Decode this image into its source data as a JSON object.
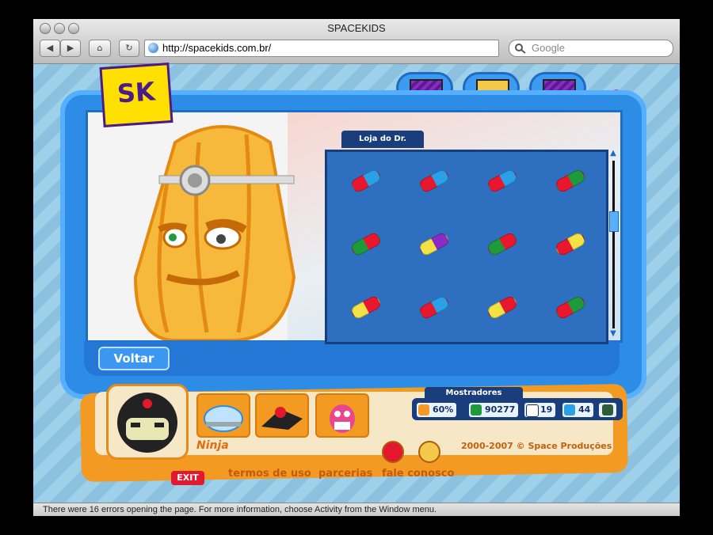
{
  "window": {
    "title": "SPACEKIDS"
  },
  "toolbar": {
    "url": "http://spacekids.com.br/",
    "search_placeholder": "Google",
    "back_label": "◀",
    "forward_label": "▶",
    "home_label": "⌂",
    "reload_label": "↻"
  },
  "status": {
    "message": "There were 16 errors opening the page. For more information, choose Activity from the Window menu."
  },
  "game": {
    "logo_text": "SK",
    "help_label": "?",
    "shop_title": "Loja do Dr. Mammon",
    "back_button": "Voltar",
    "pills": [
      {
        "left": "#e8172d",
        "right": "#2aa0e6"
      },
      {
        "left": "#e8172d",
        "right": "#2aa0e6"
      },
      {
        "left": "#e8172d",
        "right": "#2aa0e6"
      },
      {
        "left": "#e8172d",
        "right": "#1f9a3a"
      },
      {
        "left": "#1f9a3a",
        "right": "#e8172d"
      },
      {
        "left": "#f3e243",
        "right": "#8a2cc4"
      },
      {
        "left": "#1f9a3a",
        "right": "#e8172d"
      },
      {
        "left": "#e8172d",
        "right": "#f3e243"
      },
      {
        "left": "#f3e243",
        "right": "#e8172d"
      },
      {
        "left": "#e8172d",
        "right": "#2aa0e6"
      },
      {
        "left": "#f3e243",
        "right": "#e8172d"
      },
      {
        "left": "#e8172d",
        "right": "#1f9a3a"
      }
    ],
    "character_name": "Ninja",
    "copyright": "2000-2007 © Space Produções",
    "indicators_title": "Mostradores",
    "indicators": {
      "energy": "60%",
      "money": "90277",
      "messages": "19",
      "friends": "44"
    },
    "footer": {
      "exit": "EXIT",
      "terms": "termos de uso",
      "partners": "parcerias",
      "contact": "fale conosco"
    }
  }
}
